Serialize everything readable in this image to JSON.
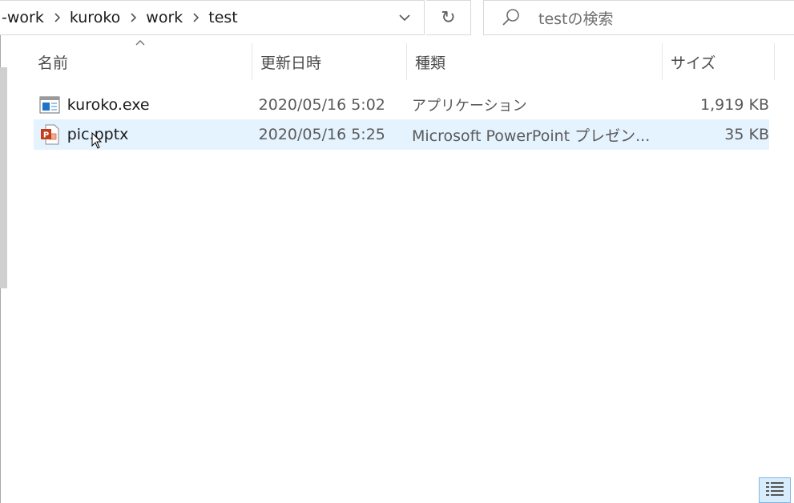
{
  "address": {
    "crumbs": [
      "-work",
      "kuroko",
      "work",
      "test"
    ],
    "separator_icon": "chevron-right-icon",
    "dropdown_icon": "chevron-down-icon"
  },
  "refresh": {
    "glyph": "↻"
  },
  "search": {
    "placeholder": "testの検索",
    "icon": "search-icon"
  },
  "columns": {
    "name": "名前",
    "date": "更新日時",
    "type": "種類",
    "size": "サイズ"
  },
  "files": [
    {
      "name": "kuroko.exe",
      "date": "2020/05/16 5:02",
      "type": "アプリケーション",
      "size": "1,919 KB",
      "icon": "application-icon"
    },
    {
      "name": "pic.pptx",
      "date": "2020/05/16 5:25",
      "type": "Microsoft PowerPoint プレゼン...",
      "size": "35 KB",
      "icon": "powerpoint-icon",
      "hovered": true
    }
  ],
  "colors": {
    "hover_row": "#e5f3ff",
    "powerpoint": "#c43e1c",
    "app_blue": "#1e73c8"
  },
  "view": {
    "details_icon": "details-view-icon"
  }
}
